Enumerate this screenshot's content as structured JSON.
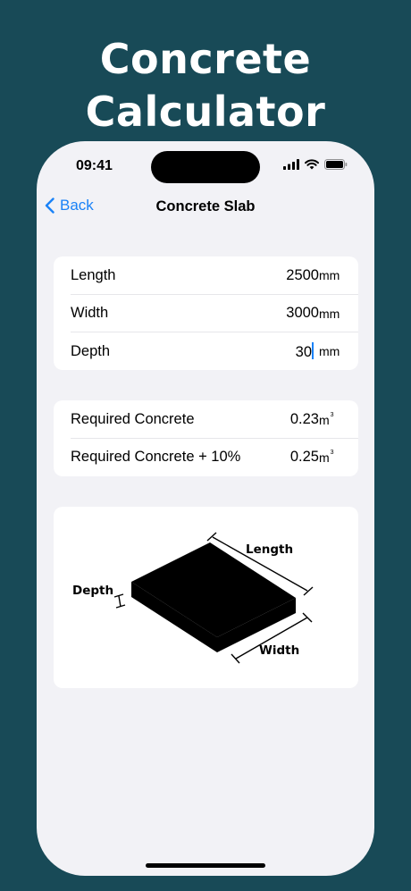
{
  "headline": {
    "line1": "Concrete",
    "line2": "Calculator"
  },
  "status_bar": {
    "time": "09:41",
    "icons": [
      "cellular-signal-icon",
      "wifi-icon",
      "battery-icon"
    ]
  },
  "nav": {
    "back_label": "Back",
    "title": "Concrete Slab"
  },
  "inputs": [
    {
      "label": "Length",
      "value": "2500",
      "unit": "mm"
    },
    {
      "label": "Width",
      "value": "3000",
      "unit": "mm"
    },
    {
      "label": "Depth",
      "value": "30",
      "unit": "mm"
    }
  ],
  "results": [
    {
      "label": "Required Concrete",
      "value": "0.23",
      "unit": "m",
      "unit_sup": "3"
    },
    {
      "label": "Required Concrete + 10%",
      "value": "0.25",
      "unit": "m",
      "unit_sup": "3"
    }
  ],
  "diagram": {
    "length_label": "Length",
    "width_label": "Width",
    "depth_label": "Depth"
  },
  "colors": {
    "background": "#184a57",
    "accent": "#1a82f7",
    "phone_bg": "#f2f2f6"
  }
}
